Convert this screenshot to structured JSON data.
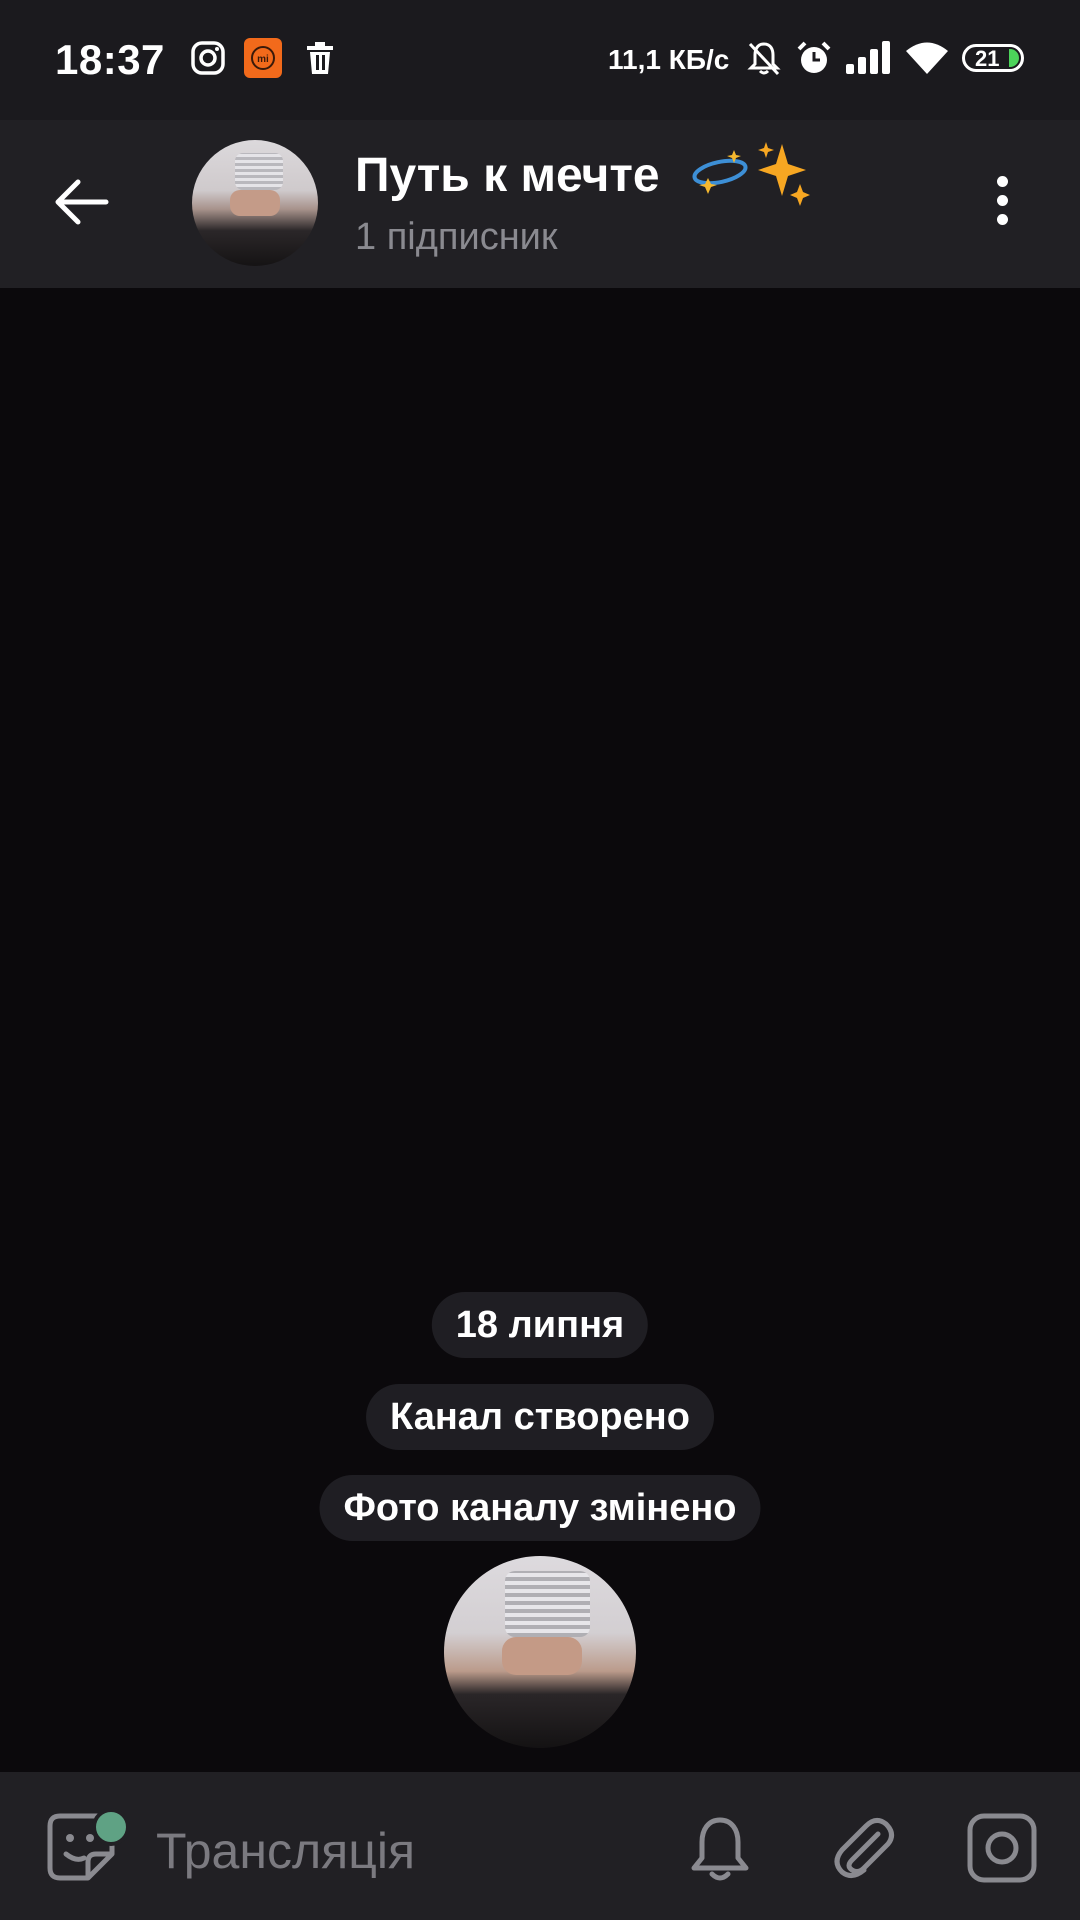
{
  "status_bar": {
    "time": "18:37",
    "net_speed": "11,1 КБ/с",
    "battery": "21",
    "icons": [
      "instagram-icon",
      "mi-icon",
      "trash-icon",
      "bell-off-icon",
      "alarm-icon",
      "signal-icon",
      "wifi-icon",
      "battery-icon"
    ]
  },
  "header": {
    "title": "Путь к мечте",
    "subtitle": "1 підписник"
  },
  "chat": {
    "date_chip": "18 липня",
    "events": [
      "Канал створено",
      "Фото каналу змінено"
    ]
  },
  "bottom_bar": {
    "placeholder": "Трансляція"
  },
  "colors": {
    "background": "#0b090c",
    "bar": "#212024",
    "status_bar": "#1b1a1e",
    "pill": "#1f1e23",
    "accent_dot": "#5fa284",
    "muted_text": "#8a8a90"
  }
}
